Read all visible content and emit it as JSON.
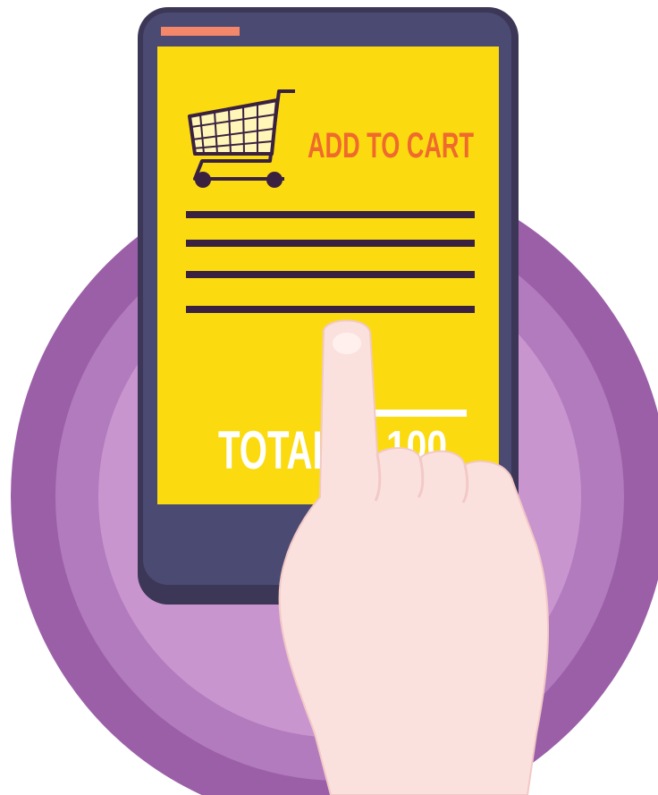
{
  "screen": {
    "add_to_cart_label": "ADD TO CART",
    "total_label": "TOTAL",
    "total_amount": "100"
  },
  "colors": {
    "background": "#ffffff",
    "circle_outer": "#9b5fa8",
    "circle_mid": "#b27bbd",
    "circle_inner": "#c995cf",
    "phone_body": "#3c3756",
    "phone_bezel": "#4b4a73",
    "screen": "#fbdb10",
    "status_bar": "#f4866a",
    "heading": "#ef6a2c",
    "lines": "#3a2140",
    "total_text": "#ffffff",
    "hand": "#fbe1de",
    "hand_shadow": "#f2c9c6"
  },
  "icons": {
    "cart": "shopping-cart-icon",
    "hand": "pointing-hand"
  }
}
